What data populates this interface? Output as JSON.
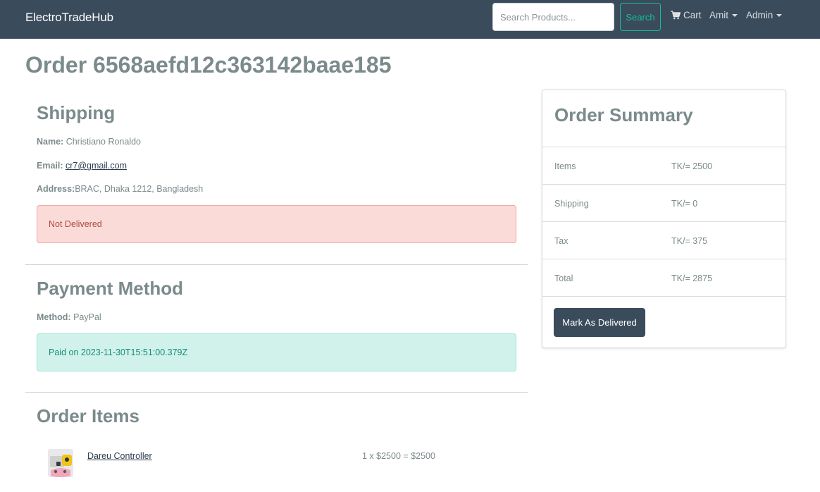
{
  "navbar": {
    "brand": "ElectroTradeHub",
    "search": {
      "placeholder": "Search Products...",
      "value": "",
      "button_label": "Search"
    },
    "cart_label": "Cart",
    "user_menu_label": "Amit",
    "admin_menu_label": "Admin"
  },
  "page": {
    "title": "Order 6568aefd12c363142baae185"
  },
  "shipping": {
    "heading": "Shipping",
    "name_label": "Name:",
    "name_value": "Christiano Ronaldo",
    "email_label": "Email:",
    "email_value": "cr7@gmail.com",
    "address_label": "Address:",
    "address_value": "BRAC, Dhaka 1212, Bangladesh",
    "delivery_status": "Not Delivered"
  },
  "payment": {
    "heading": "Payment Method",
    "method_label": "Method:",
    "method_value": "PayPal",
    "status": "Paid on 2023-11-30T15:51:00.379Z"
  },
  "order_items": {
    "heading": "Order Items",
    "items": [
      {
        "name": "Dareu Controller",
        "calc": "1 x $2500 = $2500"
      }
    ]
  },
  "summary": {
    "heading": "Order Summary",
    "rows": [
      {
        "label": "Items",
        "value": "TK/= 2500"
      },
      {
        "label": "Shipping",
        "value": "TK/= 0"
      },
      {
        "label": "Tax",
        "value": "TK/= 375"
      },
      {
        "label": "Total",
        "value": "TK/= 2875"
      }
    ],
    "button_label": "Mark As Delivered"
  },
  "colors": {
    "navbar_bg": "#3a4b5c",
    "accent": "#18bc9c",
    "danger_bg": "#fadbd8",
    "success_bg": "#d1f2eb",
    "text_muted": "#7b8a8b"
  },
  "icons": {
    "cart": "shopping-cart-icon",
    "caret": "caret-down-icon"
  }
}
